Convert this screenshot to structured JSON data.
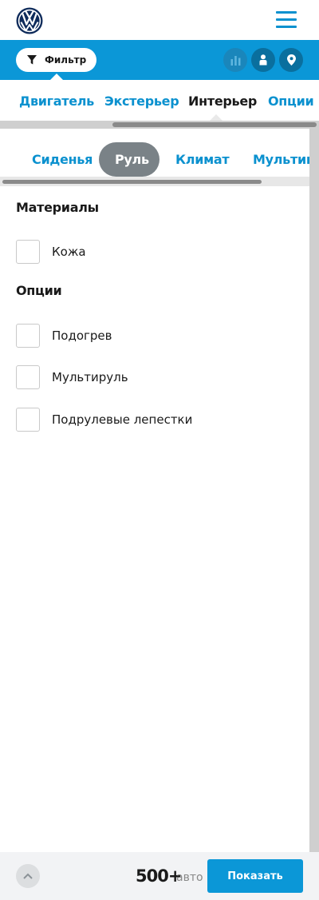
{
  "header": {
    "logo_icon": "vw-logo-icon",
    "menu_icon": "hamburger-menu-icon"
  },
  "toolbar": {
    "filter_label": "Фильтр",
    "filter_icon": "funnel-icon",
    "actions": [
      {
        "icon": "bar-chart-icon",
        "state": "disabled"
      },
      {
        "icon": "person-icon",
        "state": "enabled"
      },
      {
        "icon": "location-pin-icon",
        "state": "enabled"
      }
    ]
  },
  "category_tabs": [
    {
      "label": "Двигатель",
      "active": false
    },
    {
      "label": "Экстерьер",
      "active": false
    },
    {
      "label": "Интерьер",
      "active": true
    },
    {
      "label": "Опции",
      "active": false
    }
  ],
  "sub_tabs": [
    {
      "label": "Сиденья",
      "active": false
    },
    {
      "label": "Руль",
      "active": true
    },
    {
      "label": "Климат",
      "active": false
    },
    {
      "label": "Мультимедиа",
      "active": false
    }
  ],
  "sections": [
    {
      "title": "Материалы",
      "options": [
        {
          "label": "Кожа",
          "checked": false
        }
      ]
    },
    {
      "title": "Опции",
      "options": [
        {
          "label": "Подогрев",
          "checked": false
        },
        {
          "label": "Мультируль",
          "checked": false
        },
        {
          "label": "Подрулевые лепестки",
          "checked": false
        }
      ]
    }
  ],
  "footer": {
    "count": "500+",
    "count_unit": "авто",
    "show_label": "Показать",
    "up_icon": "chevron-up-icon"
  },
  "colors": {
    "brand_blue": "#0b97d7",
    "link_blue": "#0b91cf",
    "pill_gray": "#7a8287"
  }
}
